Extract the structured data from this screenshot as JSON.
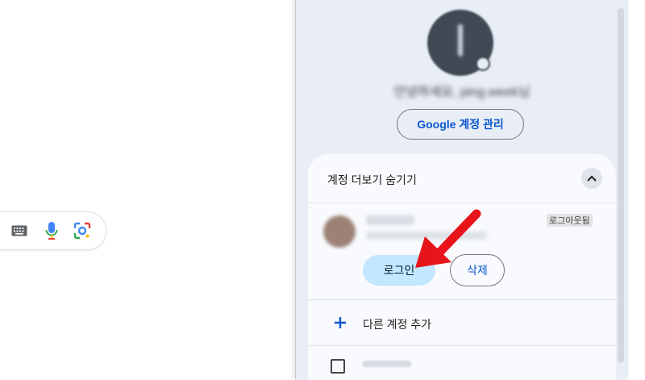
{
  "search": {
    "icons": [
      "keyboard-icon",
      "microphone-icon",
      "google-lens-icon"
    ]
  },
  "account_panel": {
    "email": "안녕하세요, ping.week님",
    "manage_button": "Google 계정 관리",
    "toggle_label": "계정 더보기 숨기기",
    "signed_out_badge": "로그아웃됨",
    "login_button": "로그인",
    "delete_button": "삭제",
    "add_account": "다른 계정 추가"
  },
  "colors": {
    "panel_bg": "#e9eef6",
    "card_bg": "#f8fafd",
    "accent_blue": "#0b57d0",
    "login_bg": "#c2e7ff",
    "annotation_red": "#e8141b"
  }
}
